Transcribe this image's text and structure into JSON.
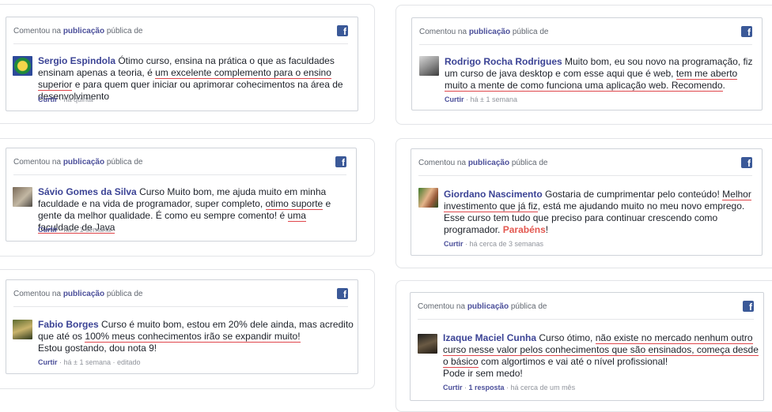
{
  "header": {
    "pre": "Comentou na",
    "pub": "publicação",
    "post": "pública de"
  },
  "fb_icon_glyph": "f",
  "meta_like": "Curtir",
  "comments": [
    {
      "author": "Sergio Espindola",
      "t1": " Ótimo curso, ensina na prática o que as faculdades ensinam apenas a teoria, é ",
      "u1": "um excelente complemento para o ensino superior",
      "t2": " e para quem quer iniciar ou aprimorar cohecimentos na área de desenvolvimento",
      "time": "na quinta"
    },
    {
      "author": "Rodrigo Rocha Rodrigues",
      "t1": " Muito bom, eu sou novo na programação, fiz um curso de java desktop e com esse aqui que é web, ",
      "u1": "tem me aberto muito a mente de como funciona uma aplicação web. Recomendo",
      "t2": ".",
      "time": "há ± 1 semana"
    },
    {
      "author": "Sávio Gomes da Silva",
      "t1": " Curso Muito bom, me ajuda muito em minha faculdade e na vida de programador, super completo, ",
      "u1": "otimo suporte",
      "t2": " e gente da melhor qualidade. É como eu sempre comento! é ",
      "u2": "uma faculdade de Java",
      "time": "há ± 1 semana"
    },
    {
      "author": "Giordano Nascimento",
      "t1": " Gostaria de cumprimentar pelo conteúdo! ",
      "u1": "Melhor investimento que já fiz",
      "t2": ", está me ajudando muito no meu novo emprego. Esse curso tem tudo que preciso para continuar crescendo como programador. ",
      "red": "Parabéns",
      "t3": "!",
      "time": "há cerca de 3 semanas"
    },
    {
      "author": "Fabio Borges",
      "t1": " Curso é muito bom, estou em 20% dele ainda, mas acredito que até os ",
      "u1": "100% meus conhecimentos irão se expandir muito!",
      "line2": "Estou gostando, dou nota 9!",
      "time": "há ± 1 semana",
      "edited": "editado"
    },
    {
      "author": "Izaque Maciel Cunha",
      "t1": " Curso ótimo, ",
      "u1": "não existe no mercado nenhum outro curso nesse valor pelos conhecimentos que são ensinados, começa desde o básico",
      "t2": " com algortimos e vai até o nível profissional!",
      "line2": "Pode ir sem medo!",
      "replies": "1 resposta",
      "time": "há cerca de um mês"
    }
  ]
}
